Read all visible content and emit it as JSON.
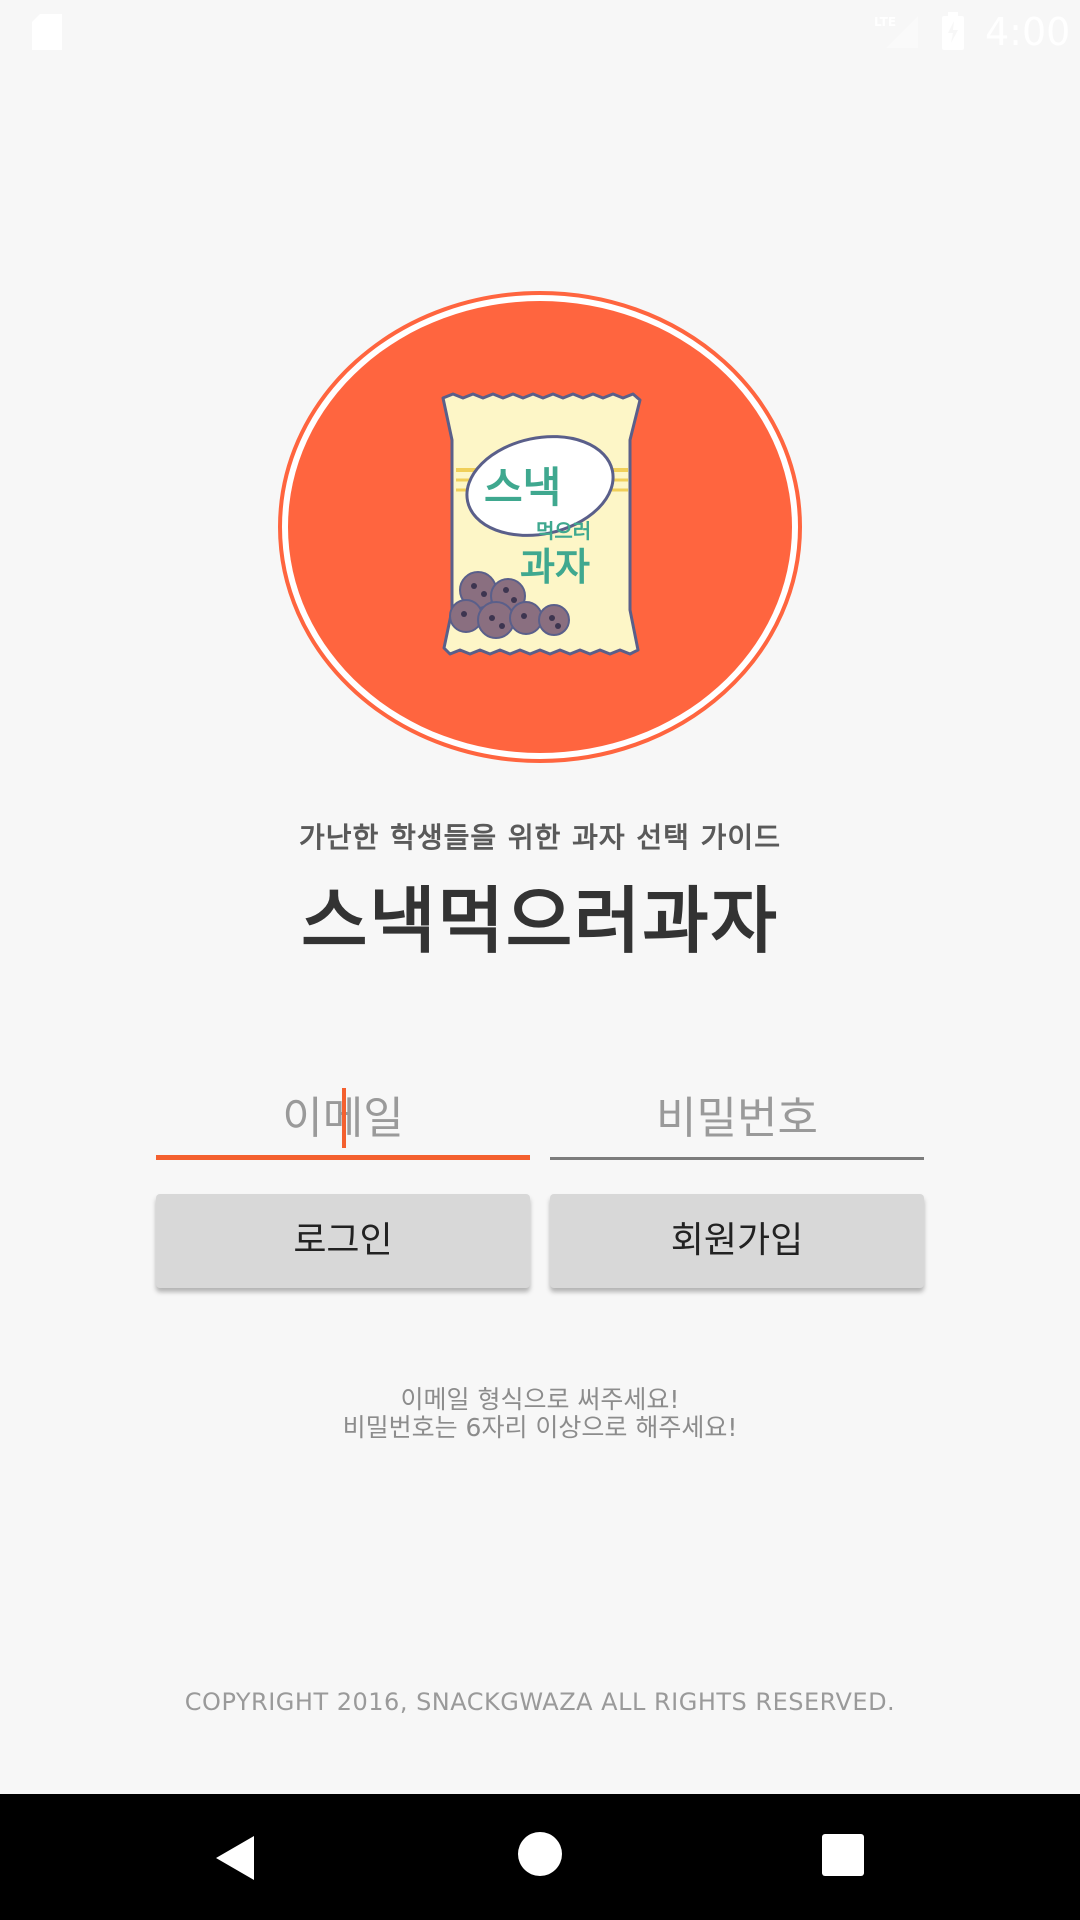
{
  "status_bar": {
    "time": "4:00",
    "icons": [
      "sd-card-icon",
      "lte-signal-icon",
      "battery-charging-icon"
    ]
  },
  "logo": {
    "line1": "스낵",
    "line2": "먹으러",
    "line3": "과자",
    "colors": {
      "circle": "#ff653f",
      "bag": "#fdf6c7",
      "text": "#3fa88f",
      "outline": "#5a5f8a"
    }
  },
  "header": {
    "tagline": "가난한 학생들을 위한 과자 선택 가이드",
    "title": "스낵먹으러과자"
  },
  "form": {
    "email_placeholder": "이메일",
    "password_placeholder": "비밀번호",
    "login_label": "로그인",
    "signup_label": "회원가입"
  },
  "hints": {
    "line1": "이메일 형식으로 써주세요!",
    "line2": "비밀번호는 6자리 이상으로 해주세요!"
  },
  "footer": {
    "copyright": "COPYRIGHT 2016, SNACKGWAZA  ALL RIGHTS RESERVED."
  },
  "nav": {
    "icons": [
      "back-icon",
      "home-icon",
      "recents-icon"
    ]
  },
  "theme": {
    "accent": "#f4602f",
    "background": "#f7f7f7",
    "button": "#d8d8d8"
  }
}
